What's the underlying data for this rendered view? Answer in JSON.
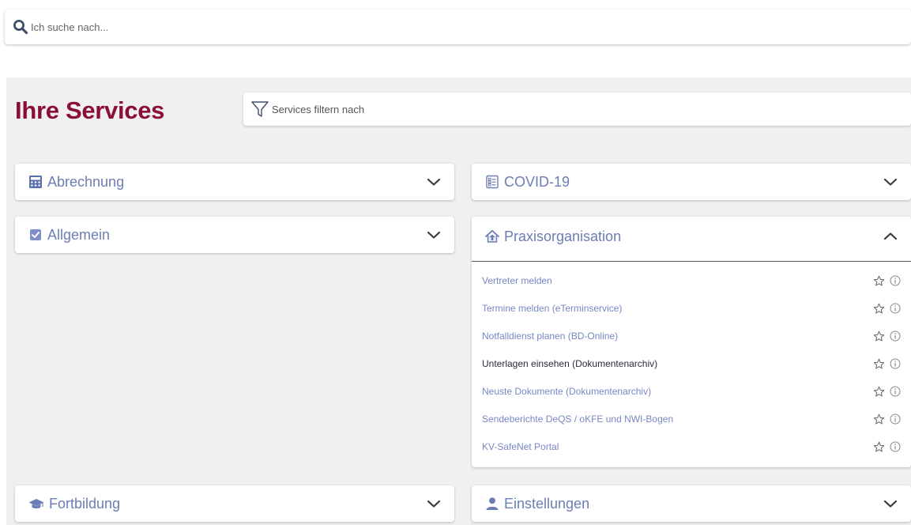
{
  "search": {
    "placeholder": "Ich suche nach..."
  },
  "services": {
    "title": "Ihre Services",
    "filter_placeholder": "Services filtern nach"
  },
  "cards": {
    "abrechnung": {
      "label": "Abrechnung",
      "icon": "calculator-icon"
    },
    "covid": {
      "label": "COVID-19",
      "icon": "checklist-icon"
    },
    "allgemein": {
      "label": "Allgemein",
      "icon": "checkbox-icon"
    },
    "praxis": {
      "label": "Praxisorganisation",
      "icon": "house-icon",
      "items": [
        {
          "label": "Vertreter melden"
        },
        {
          "label": "Termine melden (eTerminservice)"
        },
        {
          "label": "Notfalldienst planen (BD-Online)"
        },
        {
          "label": "Unterlagen einsehen (Dokumentenarchiv)"
        },
        {
          "label": "Neuste Dokumente (Dokumentenarchiv)"
        },
        {
          "label": "Sendeberichte DeQS / oKFE und NWI-Bogen"
        },
        {
          "label": "KV-SafeNet Portal"
        }
      ]
    },
    "fortbildung": {
      "label": "Fortbildung",
      "icon": "graduation-cap-icon"
    },
    "einstellungen": {
      "label": "Einstellungen",
      "icon": "user-icon"
    }
  },
  "colors": {
    "title": "#8b0d3a",
    "link": "#7787c4",
    "icon": "#6c7db4",
    "panel": "#f0f0f0"
  }
}
